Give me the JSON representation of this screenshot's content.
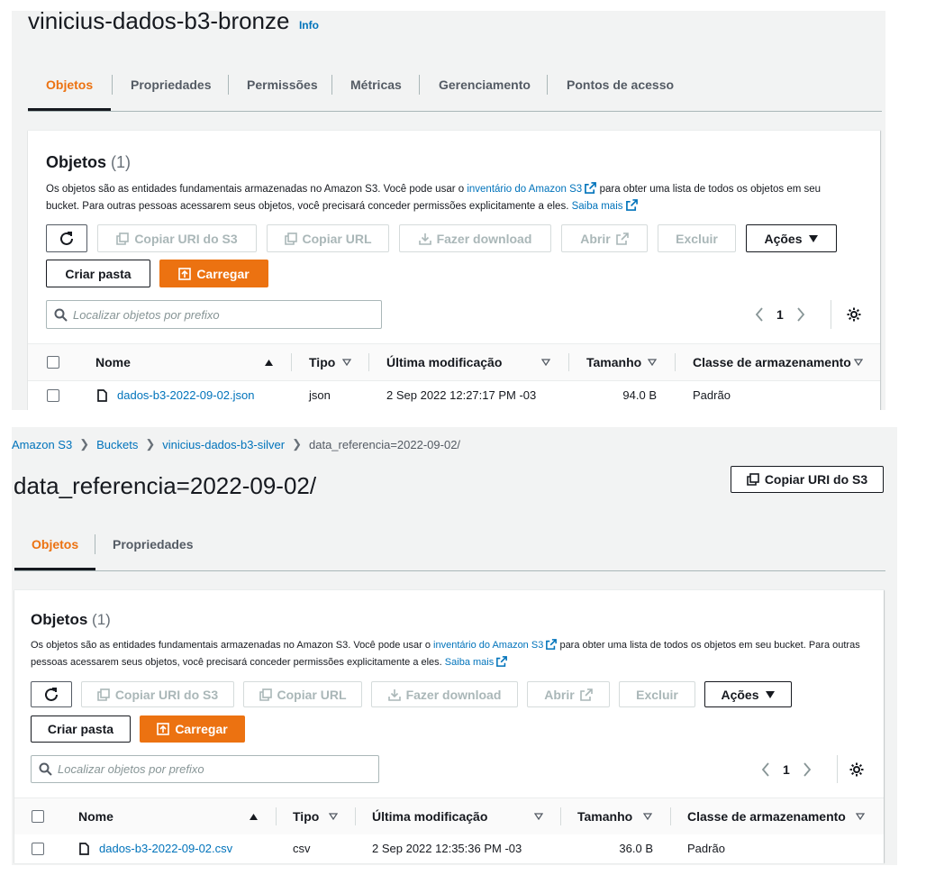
{
  "bronze": {
    "title": "vinicius-dados-b3-bronze",
    "info": "Info",
    "tabs": [
      "Objetos",
      "Propriedades",
      "Permissões",
      "Métricas",
      "Gerenciamento",
      "Pontos de acesso"
    ],
    "objects": {
      "title": "Objetos",
      "count": "(1)",
      "desc_part1": "Os objetos são as entidades fundamentais armazenadas no Amazon S3. Você pode usar o ",
      "inventory_link": "inventário do Amazon S3",
      "desc_part2": " para obter uma lista de todos os objetos em seu bucket. Para outras pessoas acessarem seus objetos, você precisará conceder permissões explicitamente a eles. ",
      "learn_more": "Saiba mais",
      "buttons": {
        "copy_uri": "Copiar URI do S3",
        "copy_url": "Copiar URL",
        "download": "Fazer download",
        "open": "Abrir",
        "delete": "Excluir",
        "actions": "Ações",
        "create_folder": "Criar pasta",
        "upload": "Carregar"
      },
      "search_placeholder": "Localizar objetos por prefixo",
      "page": "1",
      "columns": {
        "name": "Nome",
        "type": "Tipo",
        "modified": "Última modificação",
        "size": "Tamanho",
        "storage": "Classe de armazenamento"
      },
      "rows": [
        {
          "name": "dados-b3-2022-09-02.json",
          "type": "json",
          "modified": "2 Sep 2022 12:27:17 PM -03",
          "size": "94.0 B",
          "storage": "Padrão"
        }
      ]
    }
  },
  "silver": {
    "breadcrumb": [
      "Amazon S3",
      "Buckets",
      "vinicius-dados-b3-silver",
      "data_referencia=2022-09-02/"
    ],
    "title": "data_referencia=2022-09-02/",
    "copy_uri_header": "Copiar URI do S3",
    "tabs": [
      "Objetos",
      "Propriedades"
    ],
    "objects": {
      "title": "Objetos",
      "count": "(1)",
      "desc_part1": "Os objetos são as entidades fundamentais armazenadas no Amazon S3. Você pode usar o ",
      "inventory_link": "inventário do Amazon S3",
      "desc_part2": " para obter uma lista de todos os objetos em seu bucket. Para outras pessoas acessarem seus objetos, você precisará conceder permissões explicitamente a eles. ",
      "learn_more": "Saiba mais",
      "buttons": {
        "copy_uri": "Copiar URI do S3",
        "copy_url": "Copiar URL",
        "download": "Fazer download",
        "open": "Abrir",
        "delete": "Excluir",
        "actions": "Ações",
        "create_folder": "Criar pasta",
        "upload": "Carregar"
      },
      "search_placeholder": "Localizar objetos por prefixo",
      "page": "1",
      "columns": {
        "name": "Nome",
        "type": "Tipo",
        "modified": "Última modificação",
        "size": "Tamanho",
        "storage": "Classe de armazenamento"
      },
      "rows": [
        {
          "name": "dados-b3-2022-09-02.csv",
          "type": "csv",
          "modified": "2 Sep 2022 12:35:36 PM -03",
          "size": "36.0 B",
          "storage": "Padrão"
        }
      ]
    }
  },
  "colors": {
    "accent": "#ec7211",
    "link": "#0073bb",
    "text": "#16191f",
    "muted": "#545b64"
  }
}
